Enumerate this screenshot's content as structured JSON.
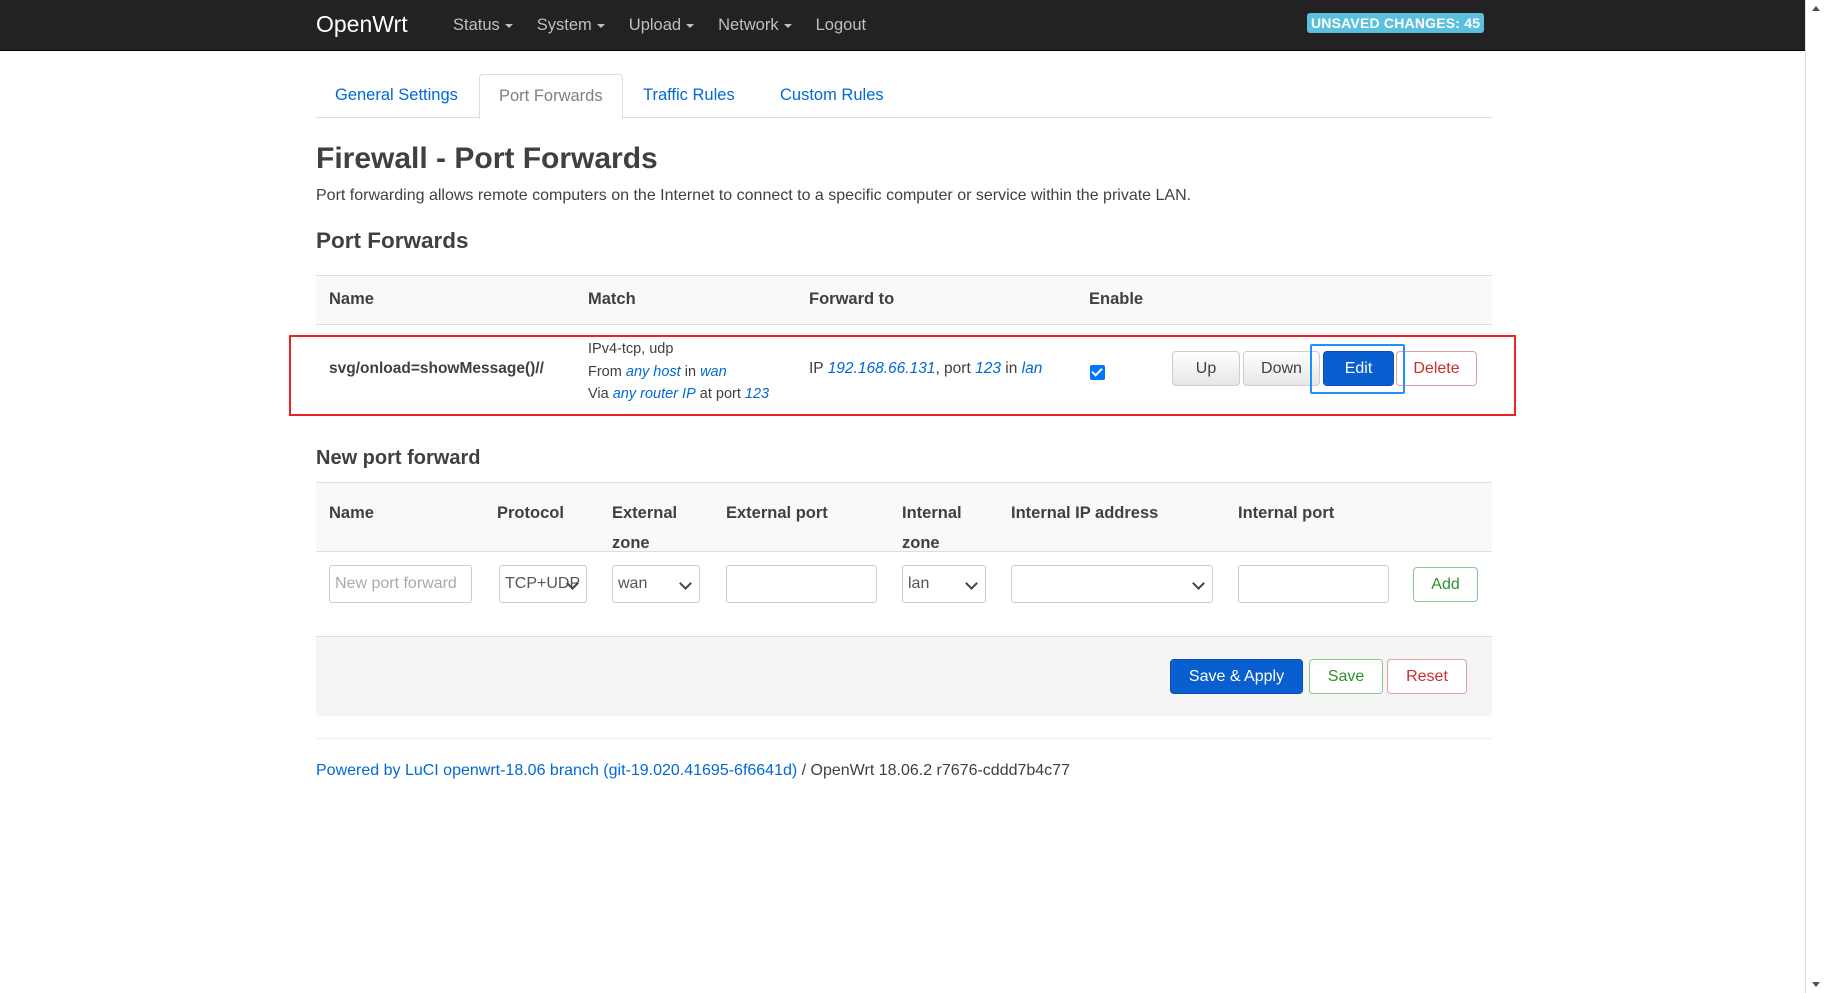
{
  "navbar": {
    "brand": "OpenWrt",
    "menu": [
      "Status",
      "System",
      "Upload",
      "Network"
    ],
    "logout": "Logout",
    "unsaved": "UNSAVED CHANGES: 45"
  },
  "tabs": [
    "General Settings",
    "Port Forwards",
    "Traffic Rules",
    "Custom Rules"
  ],
  "page": {
    "title": "Firewall - Port Forwards",
    "description": "Port forwarding allows remote computers on the Internet to connect to a specific computer or service within the private LAN.",
    "section_title": "Port Forwards"
  },
  "pf_table": {
    "headers": [
      "Name",
      "Match",
      "Forward to",
      "Enable"
    ],
    "rows": [
      {
        "name": "svg/onload=showMessage()//",
        "match": {
          "line1": "IPv4-tcp, udp",
          "from_prefix": "From",
          "from_host": "any host",
          "in_word": "in",
          "from_zone": "wan",
          "via_prefix": "Via",
          "via_host": "any router IP",
          "at_port": "at port",
          "via_port": "123"
        },
        "forward": {
          "ip_prefix": "IP",
          "ip": "192.168.66.131",
          "port_prefix": ", port",
          "port": "123",
          "in_word": "in",
          "zone": "lan"
        },
        "enabled": true,
        "buttons": {
          "up": "Up",
          "down": "Down",
          "edit": "Edit",
          "delete": "Delete"
        }
      }
    ]
  },
  "new_forward": {
    "title": "New port forward",
    "headers": [
      "Name",
      "Protocol",
      "External zone",
      "External port",
      "Internal zone",
      "Internal IP address",
      "Internal port"
    ],
    "name_placeholder": "New port forward",
    "protocol": "TCP+UDP",
    "external_zone": "wan",
    "external_port": "",
    "internal_zone": "lan",
    "internal_ip": "",
    "internal_port": "",
    "add_label": "Add"
  },
  "actions": {
    "save_apply": "Save & Apply",
    "save": "Save",
    "reset": "Reset"
  },
  "footer": {
    "link": "Powered by LuCI openwrt-18.06 branch (git-19.020.41695-6f6641d)",
    "version": " / OpenWrt 18.06.2 r7676-cddd7b4c77"
  },
  "colors": {
    "navbar": "#222222",
    "primary": "#0a5fd0",
    "highlight_row": "#ee2222",
    "highlight_edit": "#1e90ff",
    "badge": "#5bc0de"
  }
}
